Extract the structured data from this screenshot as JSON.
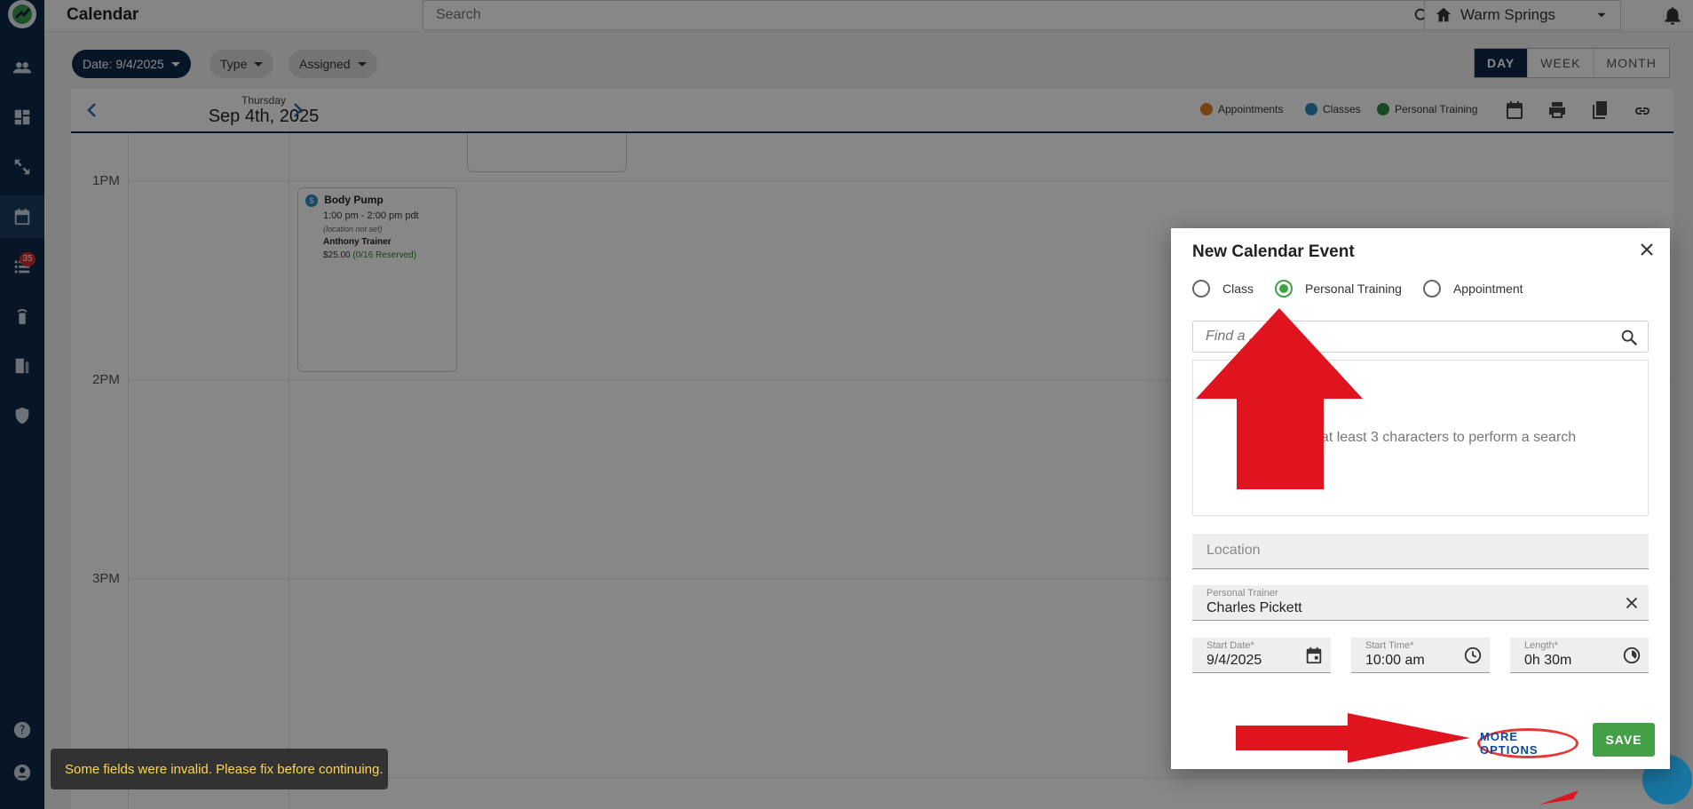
{
  "app": {
    "title": "Calendar"
  },
  "search": {
    "placeholder": "Search"
  },
  "location": {
    "name": "Warm Springs"
  },
  "sidebar": {
    "tasks_badge": "35"
  },
  "filters": {
    "date_label": "Date: 9/4/2025",
    "type_label": "Type",
    "assigned_label": "Assigned"
  },
  "views": {
    "day": "DAY",
    "week": "WEEK",
    "month": "MONTH",
    "active": "DAY"
  },
  "calendar": {
    "weekday": "Thursday",
    "date": "Sep 4th, 2025",
    "legend": [
      {
        "label": "Appointments",
        "color": "#e67e22"
      },
      {
        "label": "Classes",
        "color": "#2a8bbf"
      },
      {
        "label": "Personal Training",
        "color": "#2e8b3c"
      }
    ],
    "hours": [
      "1PM",
      "2PM",
      "3PM"
    ],
    "event": {
      "badge": "$",
      "title": "Body Pump",
      "time": "1:00 pm - 2:00 pm pdt",
      "location": "(location not set)",
      "trainer": "Anthony Trainer",
      "price": "$25.00",
      "reserved": "(0/16 Reserved)"
    }
  },
  "modal": {
    "title": "New Calendar Event",
    "radios": {
      "class": "Class",
      "personal_training": "Personal Training",
      "appointment": "Appointment"
    },
    "selected": "Personal Training",
    "find_placeholder": "Find a ...",
    "search_hint": "...r at least 3 characters to perform a search",
    "location_placeholder": "Location",
    "trainer_label": "Personal Trainer",
    "trainer_value": "Charles Pickett",
    "start_date_label": "Start Date*",
    "start_date_value": "9/4/2025",
    "start_time_label": "Start Time*",
    "start_time_value": "10:00 am",
    "length_label": "Length*",
    "length_value": "0h  30m",
    "more_options": "MORE OPTIONS",
    "save": "SAVE"
  },
  "toast": {
    "message": "Some fields were invalid. Please fix before continuing."
  },
  "colors": {
    "navy": "#0d2a4a",
    "green": "#43a047",
    "annotation_red": "#e0141e"
  }
}
